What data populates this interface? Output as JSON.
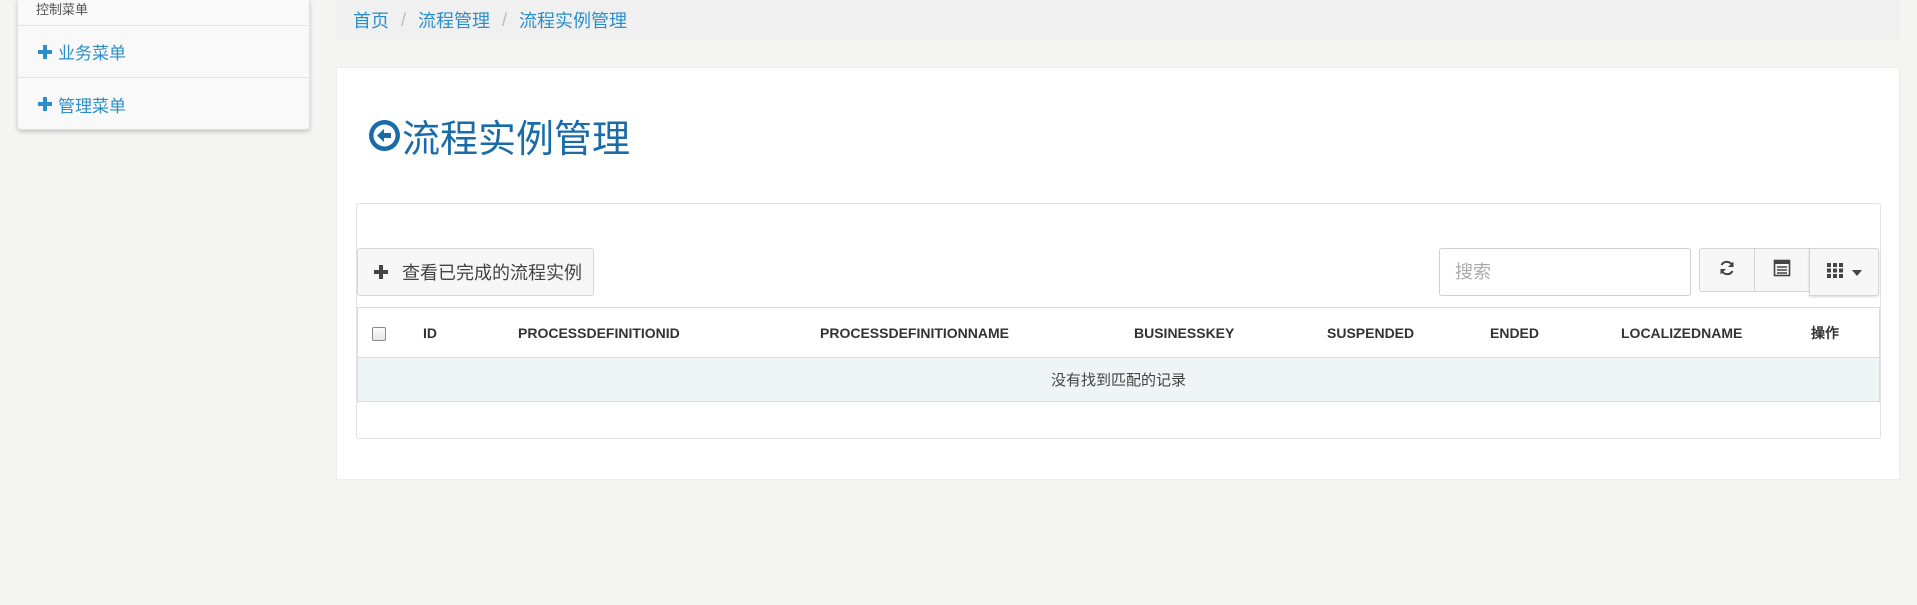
{
  "sidebar": {
    "title": "控制菜单",
    "items": [
      {
        "label": "业务菜单",
        "icon": "plus-icon"
      },
      {
        "label": "管理菜单",
        "icon": "plus-icon"
      }
    ]
  },
  "breadcrumb": {
    "items": [
      "首页",
      "流程管理",
      "流程实例管理"
    ],
    "separator": "/"
  },
  "page": {
    "title": "流程实例管理",
    "title_icon": "arrow-circle-left-icon"
  },
  "toolbar": {
    "completed_button_label": "查看已完成的流程实例",
    "search_placeholder": "搜索",
    "refresh_icon": "refresh-icon",
    "toggle_icon": "list-toggle-icon",
    "columns_icon": "grid-columns-icon"
  },
  "table": {
    "columns": [
      "ID",
      "PROCESSDEFINITIONID",
      "PROCESSDEFINITIONNAME",
      "BUSINESSKEY",
      "SUSPENDED",
      "ENDED",
      "LOCALIZEDNAME",
      "操作"
    ],
    "empty_message": "没有找到匹配的记录"
  },
  "colors": {
    "accent": "#2a8fc9",
    "title": "#1a6ca8",
    "empty_row_bg": "#eff4f7"
  }
}
